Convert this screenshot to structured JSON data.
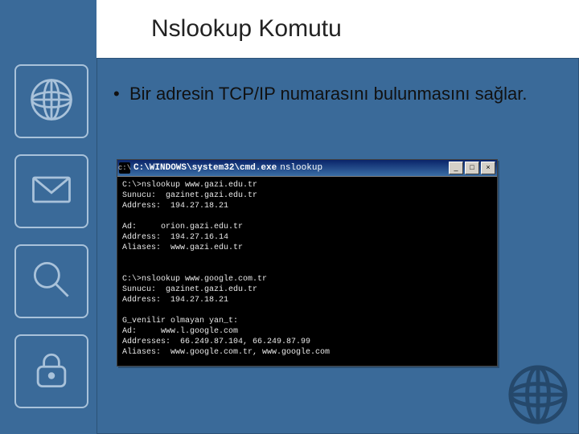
{
  "title": "Nslookup Komutu",
  "bullet_text": "Bir adresin TCP/IP numarasını bulunmasını sağlar.",
  "sidebar": {
    "items": [
      {
        "name": "globe-icon"
      },
      {
        "name": "mail-icon"
      },
      {
        "name": "search-icon"
      },
      {
        "name": "lock-icon"
      }
    ]
  },
  "cmd": {
    "icon_glyph": "c:\\",
    "title_path": "C:\\WINDOWS\\system32\\cmd.exe",
    "title_arg": "nslookup",
    "buttons": {
      "min": "_",
      "max": "□",
      "close": "×"
    },
    "lines": [
      "C:\\>nslookup www.gazi.edu.tr",
      "Sunucu:  gazinet.gazi.edu.tr",
      "Address:  194.27.18.21",
      "",
      "Ad:     orion.gazi.edu.tr",
      "Address:  194.27.16.14",
      "Aliases:  www.gazi.edu.tr",
      "",
      "",
      "C:\\>nslookup www.google.com.tr",
      "Sunucu:  gazinet.gazi.edu.tr",
      "Address:  194.27.18.21",
      "",
      "G_venilir olmayan yan_t:",
      "Ad:     www.l.google.com",
      "Addresses:  66.249.87.104, 66.249.87.99",
      "Aliases:  www.google.com.tr, www.google.com"
    ]
  }
}
